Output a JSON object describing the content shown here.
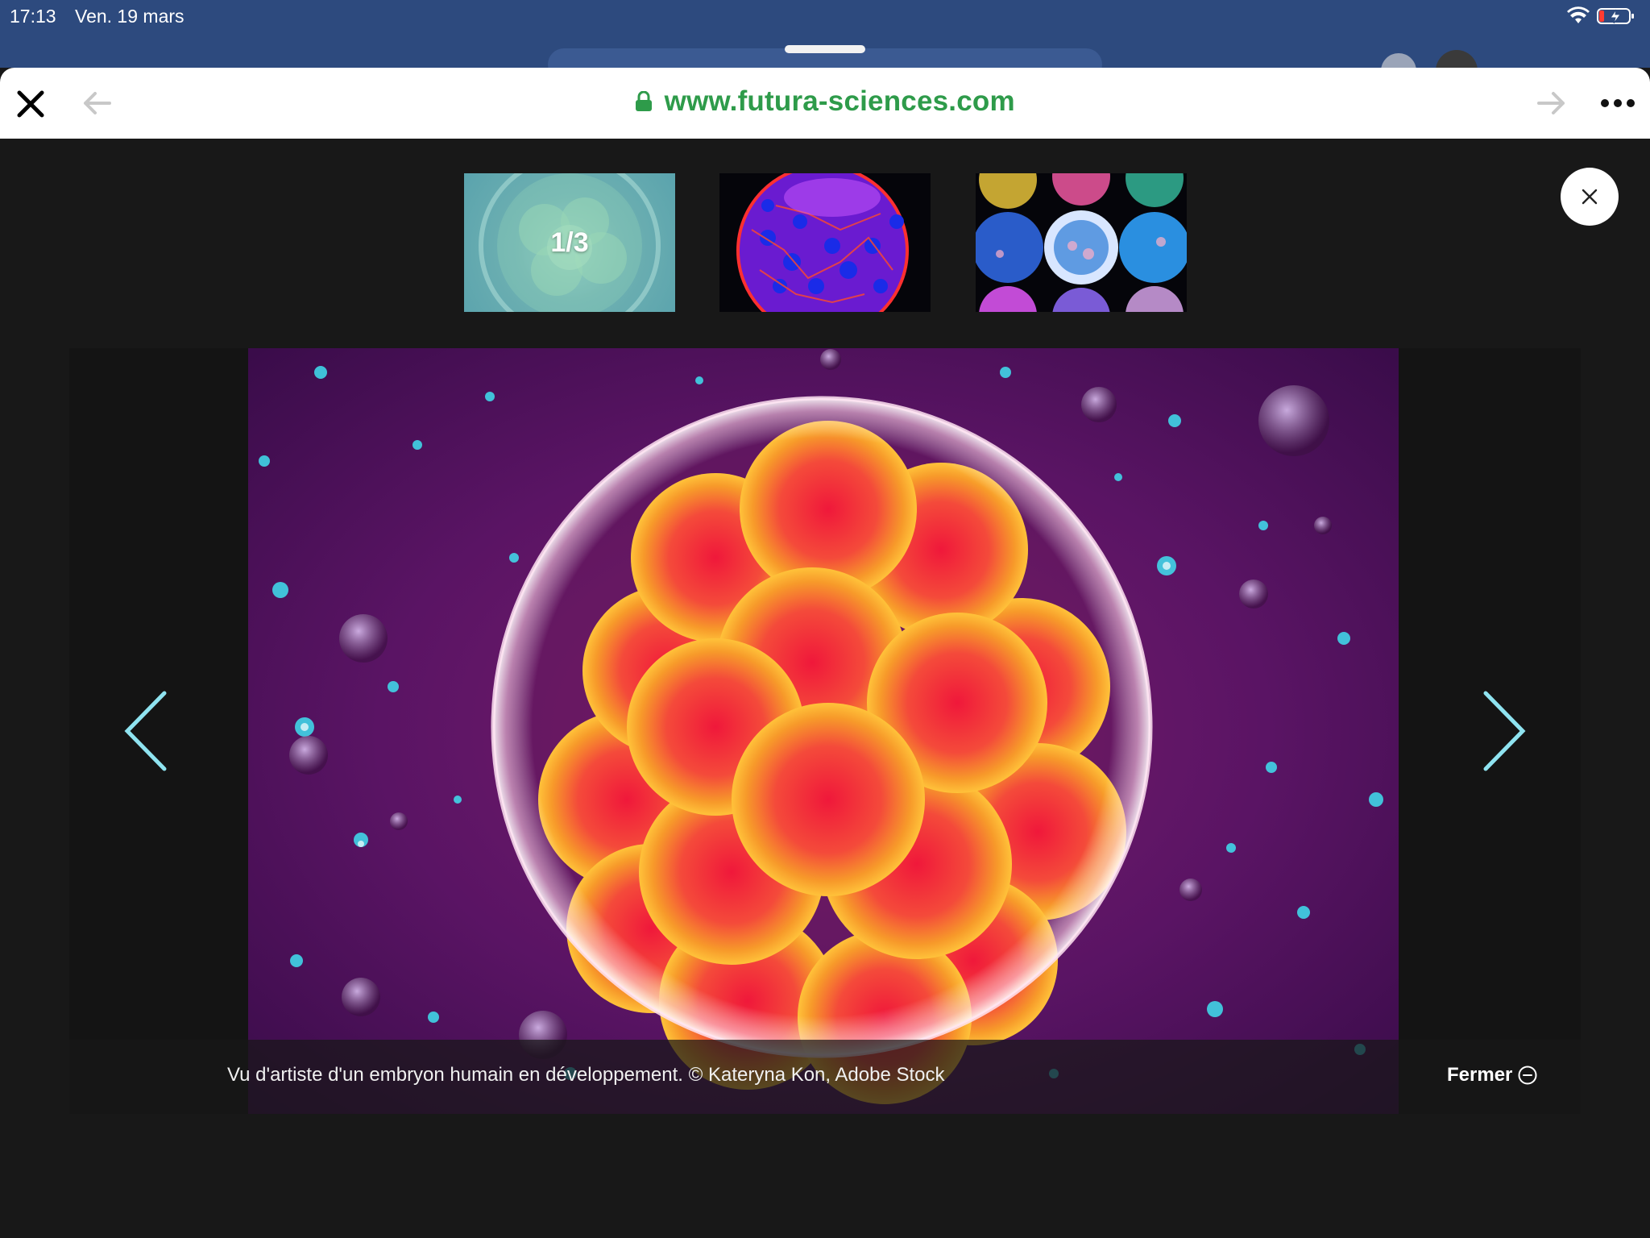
{
  "status_bar": {
    "time": "17:13",
    "date": "Ven. 19 mars"
  },
  "browser": {
    "url": "www.futura-sciences.com"
  },
  "gallery": {
    "counter": "1/3",
    "caption": "Vu d'artiste d'un embryon humain en développement. © Kateryna Kon, Adobe Stock",
    "close_label": "Fermer"
  },
  "colors": {
    "status_bar_bg": "#2d4a7e",
    "url_green": "#2e9b4a",
    "page_bg": "#181818",
    "nav_arrow": "#8fe3f0"
  },
  "icons": [
    "close-icon",
    "back-arrow-icon",
    "forward-arrow-icon",
    "lock-icon",
    "more-icon",
    "chevron-left-icon",
    "chevron-right-icon",
    "circle-minus-icon",
    "wifi-icon",
    "battery-icon"
  ]
}
